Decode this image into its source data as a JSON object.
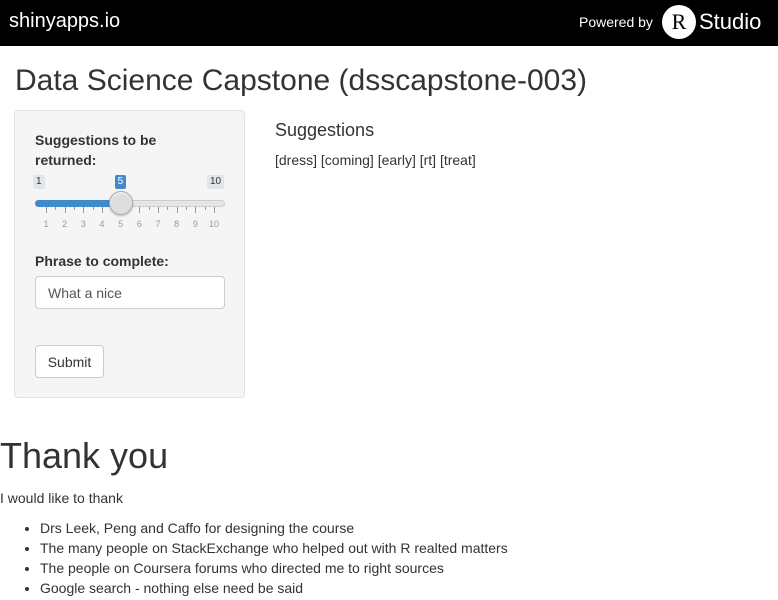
{
  "header": {
    "brand": "shinyapps.io",
    "powered_by": "Powered by",
    "rstudio_r": "R",
    "rstudio_studio": "Studio"
  },
  "app": {
    "title": "Data Science Capstone (dsscapstone-003)"
  },
  "sidebar": {
    "suggestions_label": "Suggestions to be returned:",
    "slider": {
      "min": 1,
      "max": 10,
      "value": 5,
      "min_label": "1",
      "max_label": "10",
      "value_label": "5",
      "tick_labels": [
        "1",
        "2",
        "3",
        "4",
        "5",
        "6",
        "7",
        "8",
        "9",
        "10"
      ]
    },
    "phrase_label": "Phrase to complete:",
    "phrase_value": "What a nice",
    "submit_label": "Submit"
  },
  "main": {
    "suggestions_heading": "Suggestions",
    "suggestions_output": "[dress] [coming] [early] [rt] [treat]"
  },
  "thanks": {
    "heading": "Thank you",
    "intro": "I would like to thank",
    "items": [
      "Drs Leek, Peng and Caffo for designing the course",
      "The many people on StackExchange who helped out with R realted matters",
      "The people on Coursera forums who directed me to right sources",
      "Google search - nothing else need be said"
    ]
  },
  "colors": {
    "header_bg": "#000000",
    "slider_accent": "#428bca",
    "panel_bg": "#f5f5f5"
  }
}
